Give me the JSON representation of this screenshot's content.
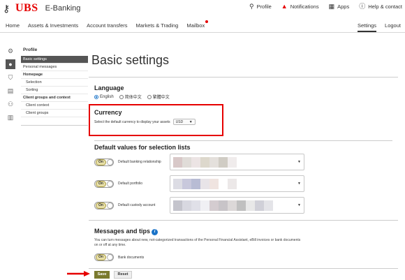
{
  "header": {
    "logo_text": "UBS",
    "app_name": "E-Banking",
    "links": [
      {
        "label": "Profile",
        "icon": "person-icon"
      },
      {
        "label": "Notifications",
        "icon": "bell-icon"
      },
      {
        "label": "Apps",
        "icon": "grid-icon"
      },
      {
        "label": "Help & contact",
        "icon": "help-icon"
      }
    ]
  },
  "nav": {
    "items": [
      "Home",
      "Assets & Investments",
      "Account transfers",
      "Markets & Trading",
      "Mailbox"
    ],
    "settings": "Settings",
    "logout": "Logout"
  },
  "menu": {
    "title": "Profile",
    "items": [
      {
        "label": "Basic settings",
        "active": true
      },
      {
        "label": "Personal messages"
      },
      {
        "label": "Homepage"
      },
      {
        "label": "Selection"
      },
      {
        "label": "Sorting"
      },
      {
        "label": "Client groups and context"
      },
      {
        "label": "Client context"
      },
      {
        "label": "Client groups"
      }
    ]
  },
  "main": {
    "title": "Basic settings",
    "language": {
      "title": "Language",
      "options": [
        {
          "label": "English",
          "selected": true
        },
        {
          "label": "简体中文",
          "selected": false
        },
        {
          "label": "繁體中文",
          "selected": false
        }
      ]
    },
    "currency": {
      "title": "Currency",
      "description": "Select the default currency to display your assets",
      "value": "USD"
    },
    "defaults": {
      "title": "Default values for selection lists",
      "toggle_label": "On",
      "rows": [
        {
          "label": "Default banking relationship"
        },
        {
          "label": "Default portfolio"
        },
        {
          "label": "Default custody account"
        }
      ]
    },
    "messages": {
      "title": "Messages and tips",
      "description": "You can turn messages about new, not-categorized transactions of the Personal Financial Assistant, eBill invoices or bank documents on or off at any time.",
      "toggle_label": "On",
      "bank_documents": "Bank documents"
    }
  },
  "footer": {
    "save": "Save",
    "reset": "Reset"
  },
  "colors": {
    "brand_red": "#e60000",
    "toggle_on": "#e8e0a8",
    "save_button": "#7a7a2e",
    "info_blue": "#1a73c8"
  }
}
